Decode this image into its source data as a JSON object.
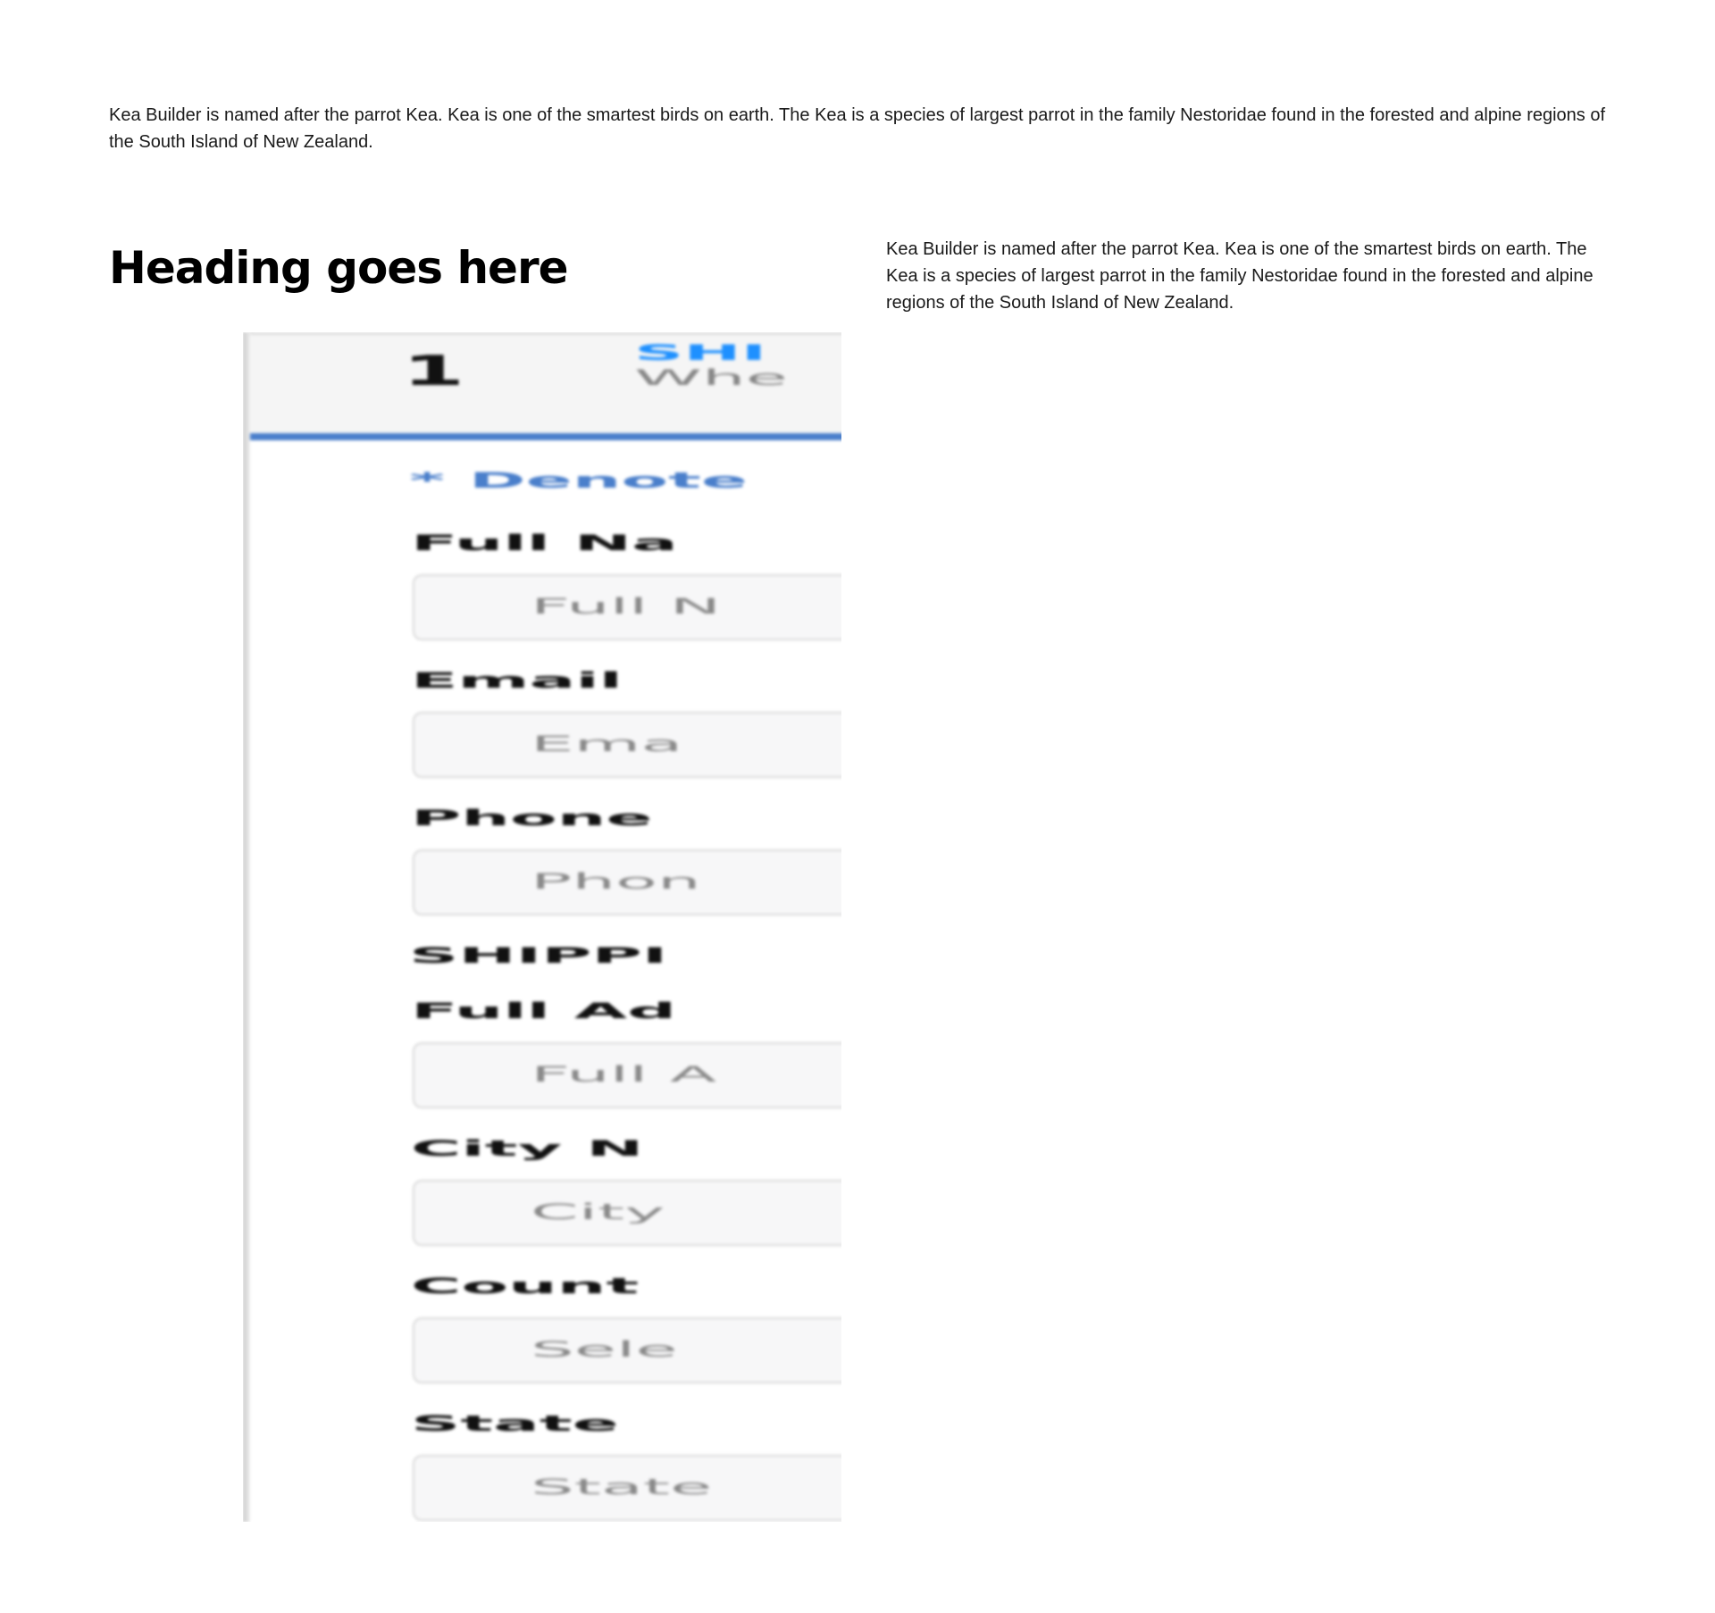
{
  "intro": {
    "text": "Kea Builder is named after the parrot Kea. Kea is one of the smartest birds on earth. The Kea is a species of largest parrot in the family Nestoridae found in the forested and alpine regions of the South Island of New Zealand."
  },
  "section": {
    "heading": "Heading goes here",
    "body": "Kea Builder is named after the parrot Kea. Kea is one of the smartest birds on earth. The Kea is a species of largest parrot in the family Nestoridae found in the forested and alpine regions of the South Island of New Zealand."
  },
  "form_image": {
    "step_number": "1",
    "step_title": "SHI",
    "step_subtitle": "Whe",
    "required_note": "* Denote",
    "fields": {
      "full_name": {
        "label": "Full Na",
        "placeholder": "Full N"
      },
      "email": {
        "label": "Email",
        "placeholder": "Ema"
      },
      "phone": {
        "label": "Phone",
        "placeholder": "Phon"
      },
      "shipping_heading": "SHIPPI",
      "full_address": {
        "label": "Full Ad",
        "placeholder": "Full A"
      },
      "city": {
        "label": "City N",
        "placeholder": "City"
      },
      "country": {
        "label": "Count",
        "placeholder": "Sele"
      },
      "state": {
        "label": "State",
        "placeholder": "State"
      }
    },
    "accent_color": "#4a7fcb",
    "title_color": "#1e90ff"
  }
}
